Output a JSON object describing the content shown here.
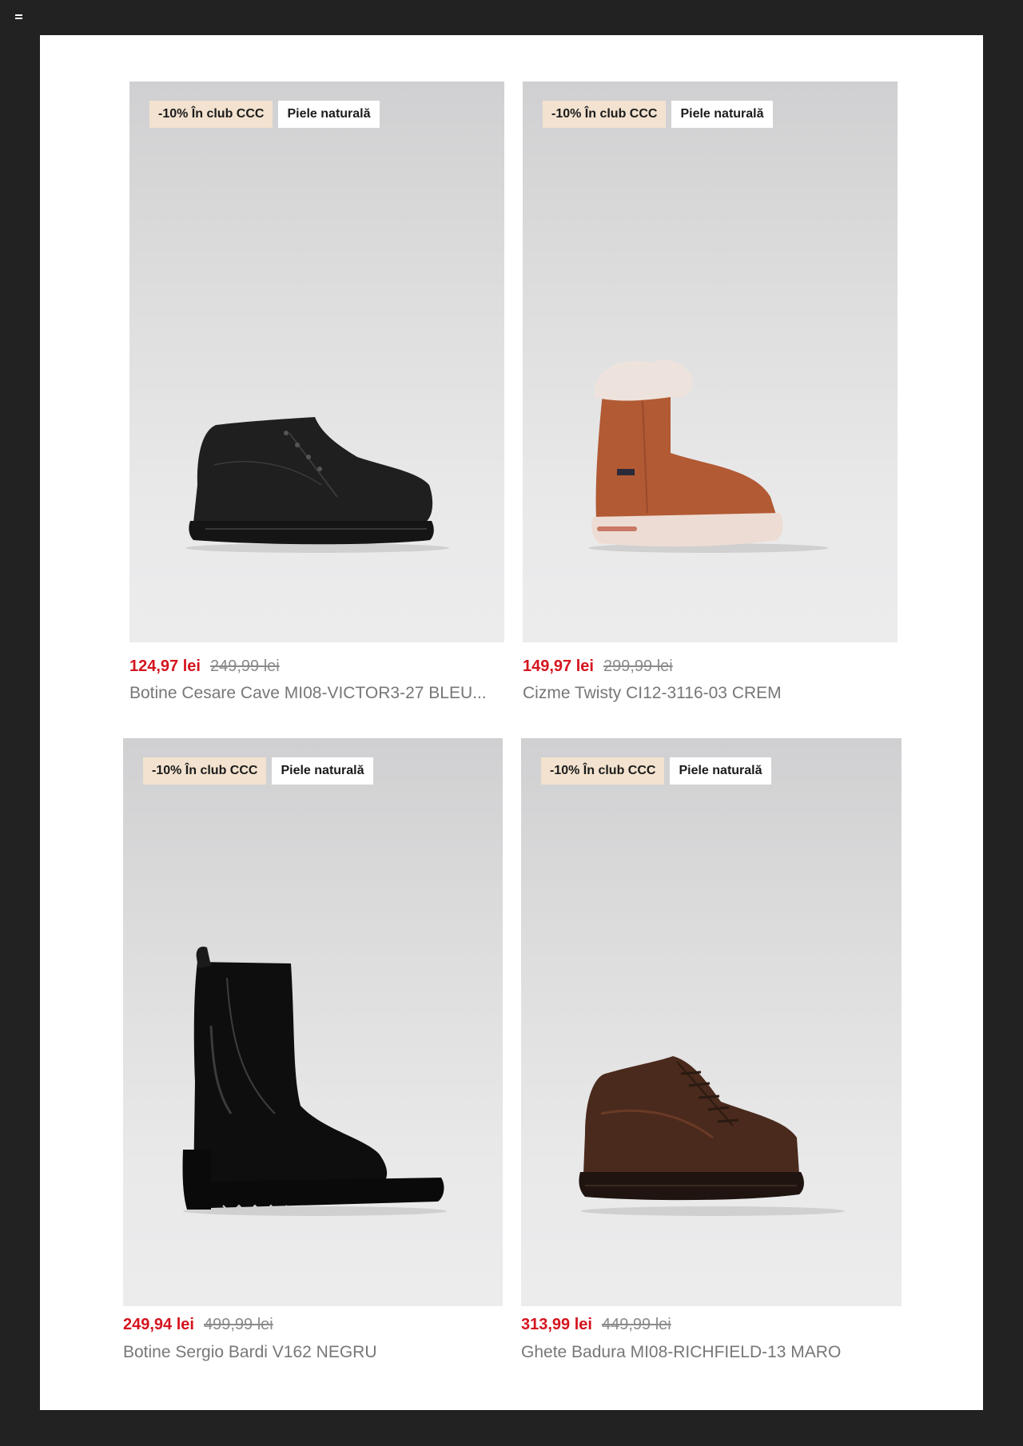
{
  "products": [
    {
      "badge_discount": "-10% În club CCC",
      "badge_material": "Piele naturală",
      "price_sale": "124,97 lei",
      "price_old": "249,99 lei",
      "name": "Botine Cesare Cave MI08-VICTOR3-27 BLEU...",
      "shoe_color": "#1f1f1f"
    },
    {
      "badge_discount": "-10% În club CCC",
      "badge_material": "Piele naturală",
      "price_sale": "149,97 lei",
      "price_old": "299,99 lei",
      "name": "Cizme Twisty CI12-3116-03 CREM",
      "shoe_color": "#b25a34"
    },
    {
      "badge_discount": "-10% În club CCC",
      "badge_material": "Piele naturală",
      "price_sale": "249,94 lei",
      "price_old": "499,99 lei",
      "name": "Botine Sergio Bardi V162 NEGRU",
      "shoe_color": "#0e0e0e"
    },
    {
      "badge_discount": "-10% În club CCC",
      "badge_material": "Piele naturală",
      "price_sale": "313,99 lei",
      "price_old": "449,99 lei",
      "name": "Ghete Badura MI08-RICHFIELD-13 MARO",
      "shoe_color": "#4a2a1c"
    }
  ],
  "colors": {
    "page_bg": "#222222",
    "sheet_bg": "#ffffff",
    "sale_price": "#d5141f",
    "club_badge_bg": "#f2e2cf"
  }
}
